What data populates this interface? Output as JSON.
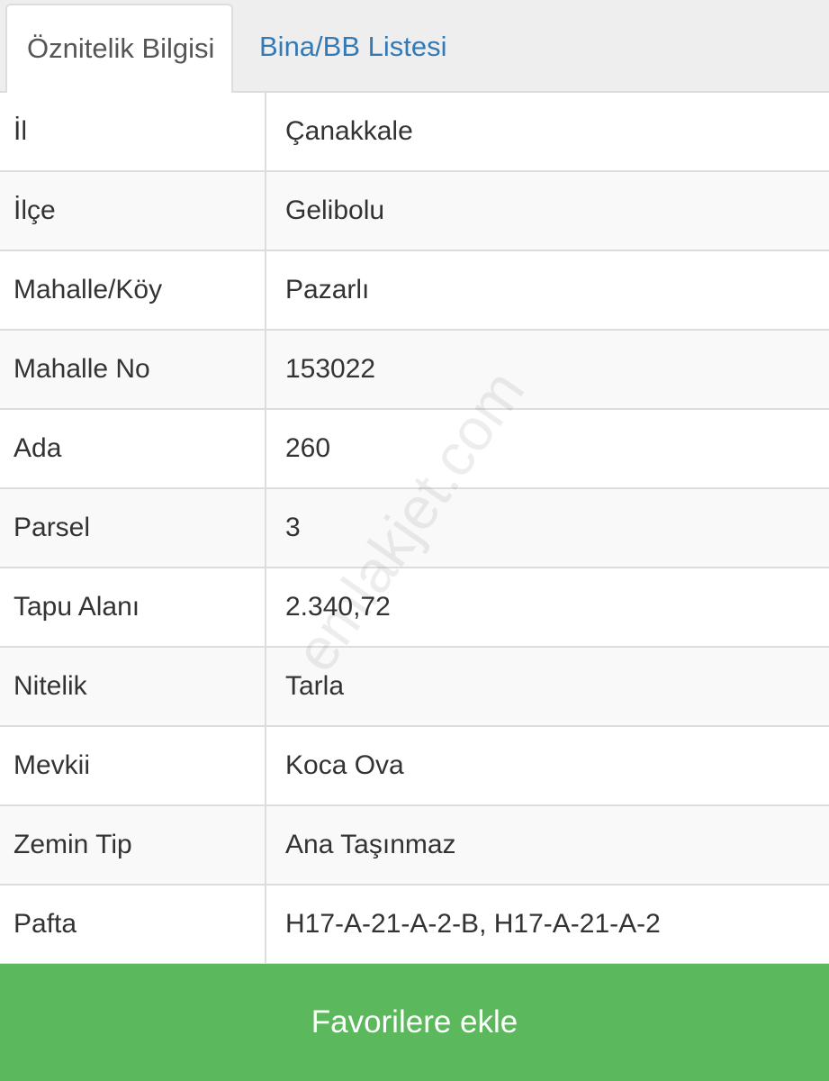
{
  "tabs": [
    {
      "label": "Öznitelik Bilgisi",
      "active": true
    },
    {
      "label": "Bina/BB Listesi",
      "active": false
    }
  ],
  "rows": [
    {
      "key": "İl",
      "value": "Çanakkale"
    },
    {
      "key": "İlçe",
      "value": "Gelibolu"
    },
    {
      "key": "Mahalle/Köy",
      "value": "Pazarlı"
    },
    {
      "key": "Mahalle No",
      "value": "153022"
    },
    {
      "key": "Ada",
      "value": "260"
    },
    {
      "key": "Parsel",
      "value": "3"
    },
    {
      "key": "Tapu Alanı",
      "value": "2.340,72"
    },
    {
      "key": "Nitelik",
      "value": "Tarla"
    },
    {
      "key": "Mevkii",
      "value": "Koca Ova"
    },
    {
      "key": "Zemin Tip",
      "value": "Ana Taşınmaz"
    },
    {
      "key": "Pafta",
      "value": "H17-A-21-A-2-B, H17-A-21-A-2"
    }
  ],
  "watermark": "emlakjet.com",
  "favorite_button": {
    "label": "Favorilere ekle"
  },
  "colors": {
    "tab_link": "#337ab7",
    "button_green": "#5cb85c"
  }
}
